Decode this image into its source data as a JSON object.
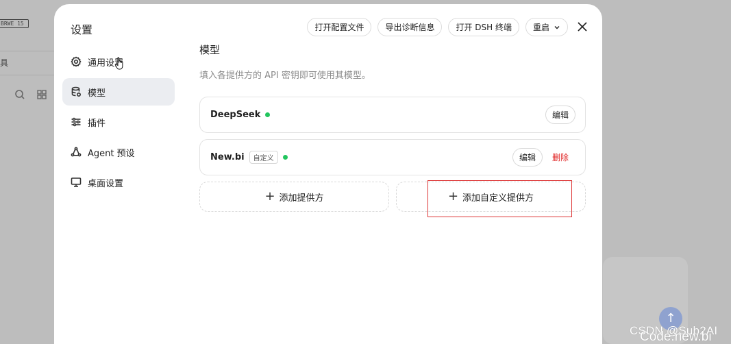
{
  "background": {
    "badge": "BRWE 15",
    "row_text": "具",
    "watermark_line1": "CSDN @Sub2AI",
    "watermark_line2": "Code.new.bi"
  },
  "modal": {
    "title": "设置",
    "actions": {
      "open_config": "打开配置文件",
      "export_diag": "导出诊断信息",
      "open_terminal": "打开 DSH 终端",
      "restart": "重启"
    }
  },
  "sidebar": {
    "items": [
      {
        "label": "通用设置",
        "icon": "gear-icon"
      },
      {
        "label": "模型",
        "icon": "database-icon",
        "active": true
      },
      {
        "label": "插件",
        "icon": "sliders-icon"
      },
      {
        "label": "Agent 预设",
        "icon": "agent-icon"
      },
      {
        "label": "桌面设置",
        "icon": "monitor-icon"
      }
    ]
  },
  "main": {
    "title": "模型",
    "description": "填入各提供方的 API 密钥即可使用其模型。",
    "providers": [
      {
        "name": "DeepSeek",
        "status": "active",
        "edit_label": "编辑"
      },
      {
        "name": "New.bi",
        "tag": "自定义",
        "status": "active",
        "edit_label": "编辑",
        "delete_label": "删除"
      }
    ],
    "add_provider": "添加提供方",
    "add_custom_provider": "添加自定义提供方"
  },
  "colors": {
    "status_active": "#22c55e",
    "danger": "#e02424",
    "active_bg": "#ebedf1"
  }
}
